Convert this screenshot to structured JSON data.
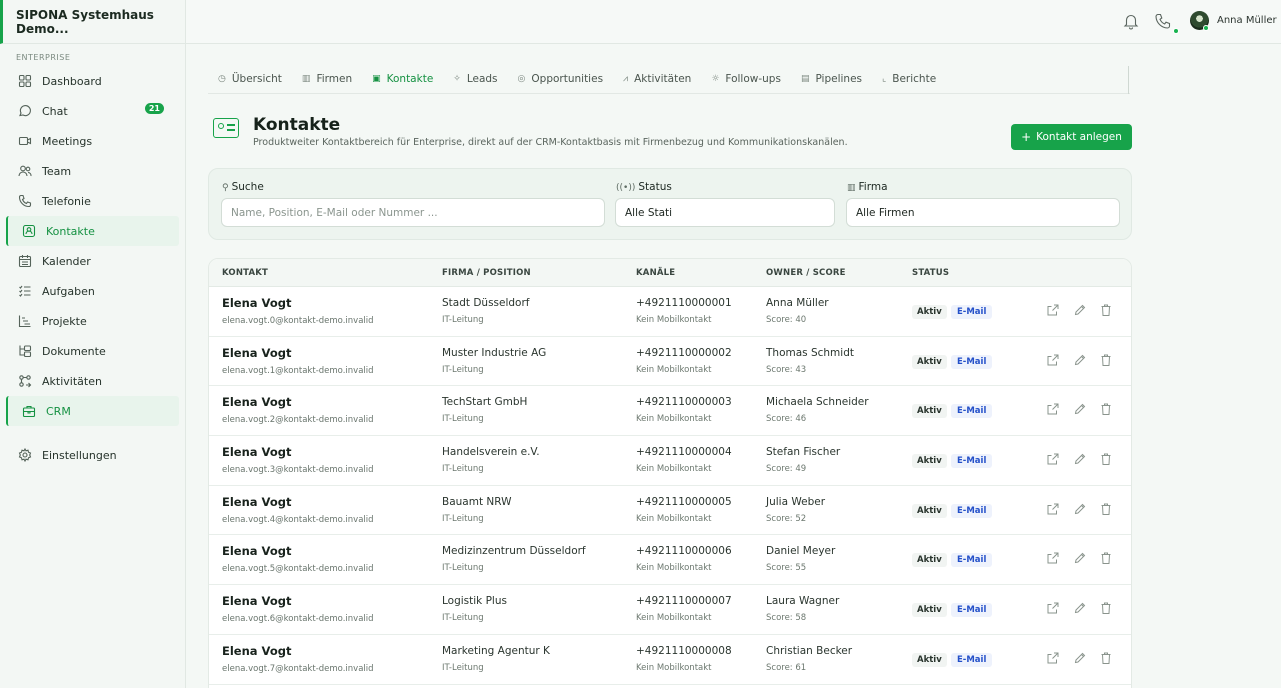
{
  "brand": "SIPONA Systemhaus Demo...",
  "sidebar": {
    "section": "ENTERPRISE",
    "items": [
      {
        "label": "Dashboard",
        "icon": "grid-icon"
      },
      {
        "label": "Chat",
        "icon": "chat-icon",
        "badge": "21"
      },
      {
        "label": "Meetings",
        "icon": "video-icon"
      },
      {
        "label": "Team",
        "icon": "users-icon"
      },
      {
        "label": "Telefonie",
        "icon": "phone-icon"
      },
      {
        "label": "Kontakte",
        "icon": "contact-card-icon"
      },
      {
        "label": "Kalender",
        "icon": "calendar-icon"
      },
      {
        "label": "Aufgaben",
        "icon": "list-check-icon"
      },
      {
        "label": "Projekte",
        "icon": "chart-icon"
      },
      {
        "label": "Dokumente",
        "icon": "folder-tree-icon"
      },
      {
        "label": "Aktivitäten",
        "icon": "activity-icon"
      },
      {
        "label": "CRM",
        "icon": "briefcase-icon"
      },
      {
        "label": "Einstellungen",
        "icon": "gear-icon"
      }
    ]
  },
  "topbar": {
    "user_name": "Anna Müller"
  },
  "tabs": [
    {
      "label": "Übersicht",
      "icon": "◷"
    },
    {
      "label": "Firmen",
      "icon": "▥"
    },
    {
      "label": "Kontakte",
      "icon": "▣"
    },
    {
      "label": "Leads",
      "icon": "✧"
    },
    {
      "label": "Opportunities",
      "icon": "◎"
    },
    {
      "label": "Aktivitäten",
      "icon": "⩘"
    },
    {
      "label": "Follow-ups",
      "icon": "☼"
    },
    {
      "label": "Pipelines",
      "icon": "▤"
    },
    {
      "label": "Berichte",
      "icon": "⌞"
    }
  ],
  "page": {
    "title": "Kontakte",
    "subtitle": "Produktweiter Kontaktbereich für Enterprise, direkt auf der CRM-Kontaktbasis mit Firmenbezug und Kommunikationskanälen.",
    "add_button": "Kontakt anlegen"
  },
  "filters": {
    "search_label": "Suche",
    "search_placeholder": "Name, Position, E-Mail oder Nummer ...",
    "status_label": "Status",
    "status_value": "Alle Stati",
    "company_label": "Firma",
    "company_value": "Alle Firmen"
  },
  "table": {
    "headers": [
      "KONTAKT",
      "FIRMA / POSITION",
      "KANÄLE",
      "OWNER / SCORE",
      "STATUS"
    ],
    "rows": [
      {
        "name": "Elena Vogt",
        "email": "elena.vogt.0@kontakt-demo.invalid",
        "company": "Stadt Düsseldorf",
        "position": "IT-Leitung",
        "phone": "+4921110000001",
        "mobile": "Kein Mobilkontakt",
        "owner": "Anna Müller",
        "score": "Score: 40",
        "status": "Aktiv",
        "channel": "E-Mail"
      },
      {
        "name": "Elena Vogt",
        "email": "elena.vogt.1@kontakt-demo.invalid",
        "company": "Muster Industrie AG",
        "position": "IT-Leitung",
        "phone": "+4921110000002",
        "mobile": "Kein Mobilkontakt",
        "owner": "Thomas Schmidt",
        "score": "Score: 43",
        "status": "Aktiv",
        "channel": "E-Mail"
      },
      {
        "name": "Elena Vogt",
        "email": "elena.vogt.2@kontakt-demo.invalid",
        "company": "TechStart GmbH",
        "position": "IT-Leitung",
        "phone": "+4921110000003",
        "mobile": "Kein Mobilkontakt",
        "owner": "Michaela Schneider",
        "score": "Score: 46",
        "status": "Aktiv",
        "channel": "E-Mail"
      },
      {
        "name": "Elena Vogt",
        "email": "elena.vogt.3@kontakt-demo.invalid",
        "company": "Handelsverein e.V.",
        "position": "IT-Leitung",
        "phone": "+4921110000004",
        "mobile": "Kein Mobilkontakt",
        "owner": "Stefan Fischer",
        "score": "Score: 49",
        "status": "Aktiv",
        "channel": "E-Mail"
      },
      {
        "name": "Elena Vogt",
        "email": "elena.vogt.4@kontakt-demo.invalid",
        "company": "Bauamt NRW",
        "position": "IT-Leitung",
        "phone": "+4921110000005",
        "mobile": "Kein Mobilkontakt",
        "owner": "Julia Weber",
        "score": "Score: 52",
        "status": "Aktiv",
        "channel": "E-Mail"
      },
      {
        "name": "Elena Vogt",
        "email": "elena.vogt.5@kontakt-demo.invalid",
        "company": "Medizinzentrum Düsseldorf",
        "position": "IT-Leitung",
        "phone": "+4921110000006",
        "mobile": "Kein Mobilkontakt",
        "owner": "Daniel Meyer",
        "score": "Score: 55",
        "status": "Aktiv",
        "channel": "E-Mail"
      },
      {
        "name": "Elena Vogt",
        "email": "elena.vogt.6@kontakt-demo.invalid",
        "company": "Logistik Plus",
        "position": "IT-Leitung",
        "phone": "+4921110000007",
        "mobile": "Kein Mobilkontakt",
        "owner": "Laura Wagner",
        "score": "Score: 58",
        "status": "Aktiv",
        "channel": "E-Mail"
      },
      {
        "name": "Elena Vogt",
        "email": "elena.vogt.7@kontakt-demo.invalid",
        "company": "Marketing Agentur K",
        "position": "IT-Leitung",
        "phone": "+4921110000008",
        "mobile": "Kein Mobilkontakt",
        "owner": "Christian Becker",
        "score": "Score: 61",
        "status": "Aktiv",
        "channel": "E-Mail"
      }
    ]
  },
  "colors": {
    "accent": "#17a34a",
    "email_badge": "#2450c9"
  }
}
